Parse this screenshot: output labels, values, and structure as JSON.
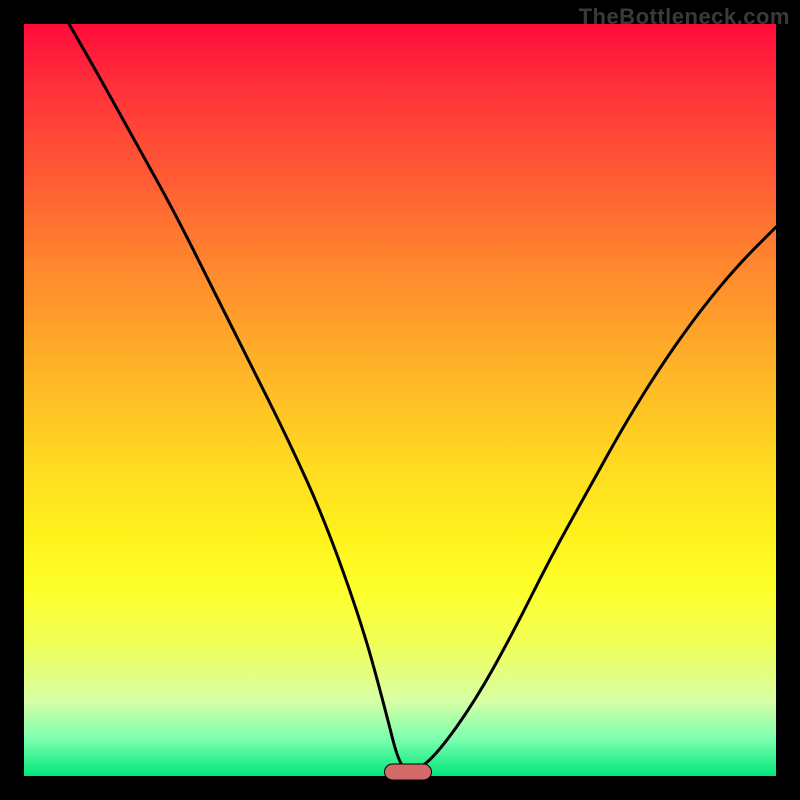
{
  "watermark": "TheBottleneck.com",
  "chart_data": {
    "type": "line",
    "title": "",
    "xlabel": "",
    "ylabel": "",
    "xlim": [
      0,
      100
    ],
    "ylim": [
      0,
      100
    ],
    "curve": {
      "x": [
        6,
        10,
        15,
        20,
        25,
        30,
        35,
        40,
        45,
        48,
        50,
        52,
        55,
        60,
        65,
        70,
        75,
        80,
        85,
        90,
        95,
        100
      ],
      "y": [
        100,
        93,
        84,
        75,
        65,
        55,
        45,
        34,
        20,
        9,
        1,
        0.5,
        3,
        10,
        19,
        29,
        38,
        47,
        55,
        62,
        68,
        73
      ]
    },
    "sweet_spot": {
      "x": 51,
      "y": 0.5
    },
    "gradient_stops": [
      {
        "pct": 0,
        "color": "#ff0b3a"
      },
      {
        "pct": 20,
        "color": "#ff5a34"
      },
      {
        "pct": 46,
        "color": "#ffb428"
      },
      {
        "pct": 68,
        "color": "#fff21c"
      },
      {
        "pct": 90,
        "color": "#d7ffa4"
      },
      {
        "pct": 100,
        "color": "#00e77a"
      }
    ]
  }
}
